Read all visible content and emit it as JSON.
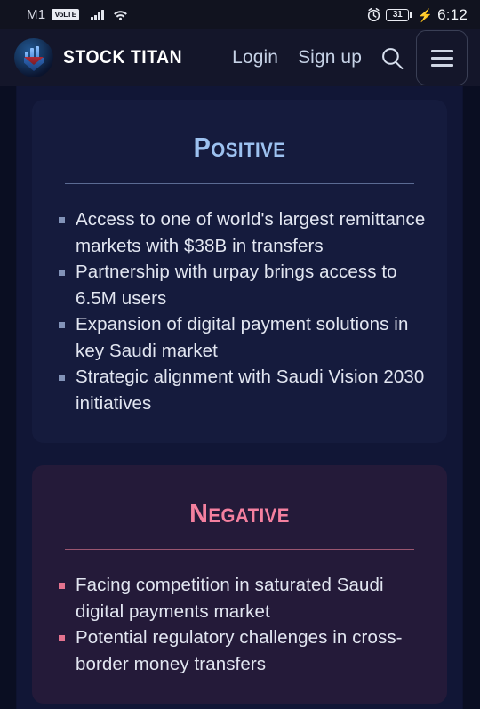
{
  "statusbar": {
    "carrier": "M1",
    "volte_badge": "VoLTE",
    "signal_icon": "signal-bars-icon",
    "wifi_icon": "wifi-icon",
    "alarm_icon": "alarm-clock-icon",
    "battery_level": "31",
    "charging_icon": "charging-bolt-icon",
    "time": "6:12"
  },
  "header": {
    "logo_icon": "stock-titan-logo-icon",
    "brand": "STOCK TITAN",
    "login_label": "Login",
    "signup_label": "Sign up",
    "search_icon": "search-icon",
    "menu_icon": "hamburger-menu-icon"
  },
  "cards": [
    {
      "key": "positive",
      "title": "Positive",
      "accent": "#9dc2f0",
      "items": [
        "Access to one of world's largest remittance markets with $38B in transfers",
        "Partnership with urpay brings access to 6.5M users",
        "Expansion of digital payment solutions in key Saudi market",
        "Strategic alignment with Saudi Vision 2030 initiatives"
      ]
    },
    {
      "key": "negative",
      "title": "Negative",
      "accent": "#f4809f",
      "items": [
        "Facing competition in saturated Saudi digital payments market",
        "Potential regulatory challenges in cross-border money transfers"
      ]
    }
  ]
}
